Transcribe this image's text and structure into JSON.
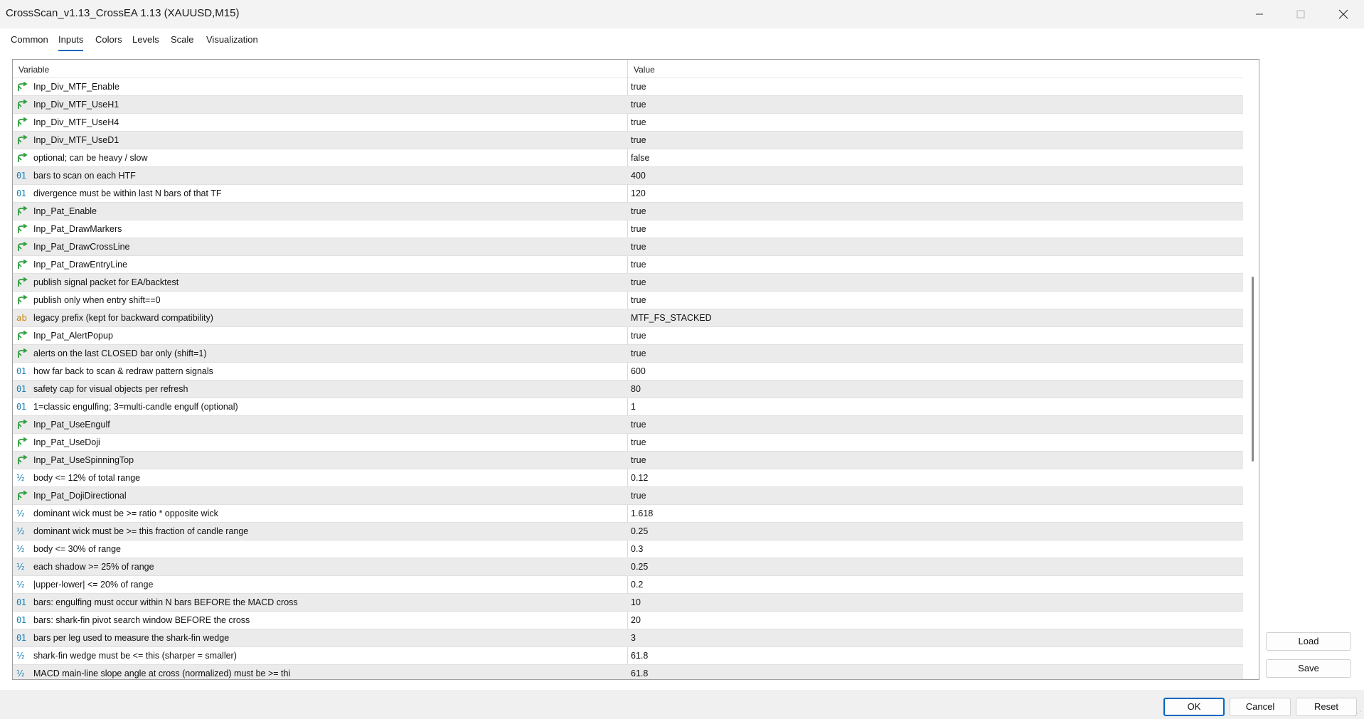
{
  "window": {
    "title": "CrossScan_v1.13_CrossEA 1.13 (XAUUSD,M15)"
  },
  "tabs": [
    {
      "label": "Common",
      "active": false
    },
    {
      "label": "Inputs",
      "active": true
    },
    {
      "label": "Colors",
      "active": false
    },
    {
      "label": "Levels",
      "active": false
    },
    {
      "label": "Scale",
      "active": false
    },
    {
      "label": "Visualization",
      "active": false
    }
  ],
  "grid": {
    "columns": {
      "variable": "Variable",
      "value": "Value"
    },
    "rows": [
      {
        "type": "bool",
        "name": "Inp_Div_MTF_Enable",
        "value": "true"
      },
      {
        "type": "bool",
        "name": "Inp_Div_MTF_UseH1",
        "value": "true"
      },
      {
        "type": "bool",
        "name": "Inp_Div_MTF_UseH4",
        "value": "true"
      },
      {
        "type": "bool",
        "name": "Inp_Div_MTF_UseD1",
        "value": "true"
      },
      {
        "type": "bool",
        "name": "optional; can be heavy / slow",
        "value": "false"
      },
      {
        "type": "int",
        "name": "bars to scan on each HTF",
        "value": "400"
      },
      {
        "type": "int",
        "name": "divergence must be within last N bars of that TF",
        "value": "120"
      },
      {
        "type": "bool",
        "name": "Inp_Pat_Enable",
        "value": "true"
      },
      {
        "type": "bool",
        "name": "Inp_Pat_DrawMarkers",
        "value": "true"
      },
      {
        "type": "bool",
        "name": "Inp_Pat_DrawCrossLine",
        "value": "true"
      },
      {
        "type": "bool",
        "name": "Inp_Pat_DrawEntryLine",
        "value": "true"
      },
      {
        "type": "bool",
        "name": "publish signal packet for EA/backtest",
        "value": "true"
      },
      {
        "type": "bool",
        "name": "publish only when entry shift==0",
        "value": "true"
      },
      {
        "type": "string",
        "name": "legacy prefix (kept for backward compatibility)",
        "value": "MTF_FS_STACKED"
      },
      {
        "type": "bool",
        "name": "Inp_Pat_AlertPopup",
        "value": "true"
      },
      {
        "type": "bool",
        "name": "alerts on the last CLOSED bar only (shift=1)",
        "value": "true"
      },
      {
        "type": "int",
        "name": "how far back to scan & redraw pattern signals",
        "value": "600"
      },
      {
        "type": "int",
        "name": "safety cap for visual objects per refresh",
        "value": "80"
      },
      {
        "type": "int",
        "name": "1=classic engulfing; 3=multi-candle engulf (optional)",
        "value": "1"
      },
      {
        "type": "bool",
        "name": "Inp_Pat_UseEngulf",
        "value": "true"
      },
      {
        "type": "bool",
        "name": "Inp_Pat_UseDoji",
        "value": "true"
      },
      {
        "type": "bool",
        "name": "Inp_Pat_UseSpinningTop",
        "value": "true"
      },
      {
        "type": "double",
        "name": "body <= 12% of total range",
        "value": "0.12"
      },
      {
        "type": "bool",
        "name": "Inp_Pat_DojiDirectional",
        "value": "true"
      },
      {
        "type": "double",
        "name": "dominant wick must be >= ratio * opposite wick",
        "value": "1.618"
      },
      {
        "type": "double",
        "name": "dominant wick must be >= this fraction of candle range",
        "value": "0.25"
      },
      {
        "type": "double",
        "name": "body <= 30% of range",
        "value": "0.3"
      },
      {
        "type": "double",
        "name": "each shadow >= 25% of range",
        "value": "0.25"
      },
      {
        "type": "double",
        "name": "|upper-lower| <= 20% of range",
        "value": "0.2"
      },
      {
        "type": "int",
        "name": "bars: engulfing must occur within N bars BEFORE the MACD cross",
        "value": "10"
      },
      {
        "type": "int",
        "name": "bars: shark-fin pivot search window BEFORE the cross",
        "value": "20"
      },
      {
        "type": "int",
        "name": "bars per leg used to measure the shark-fin wedge",
        "value": "3"
      },
      {
        "type": "double",
        "name": "shark-fin wedge must be <= this (sharper = smaller)",
        "value": "61.8"
      },
      {
        "type": "double",
        "name": "MACD main-line slope angle at cross (normalized) must be >= thi",
        "value": "61.8"
      }
    ]
  },
  "icons": {
    "bool": {
      "name": "bool-arrow-icon",
      "glyph": "",
      "color": "#2e9e3e"
    },
    "int": {
      "name": "integer-icon",
      "glyph": "01",
      "color": "#1a7fb5"
    },
    "double": {
      "name": "double-icon",
      "glyph": "½",
      "color": "#1a7fb5"
    },
    "string": {
      "name": "string-icon",
      "glyph": "ab",
      "color": "#c9871b"
    }
  },
  "side_buttons": {
    "load": "Load",
    "save": "Save"
  },
  "footer": {
    "ok": "OK",
    "cancel": "Cancel",
    "reset": "Reset"
  },
  "colors": {
    "accent": "#0067c0",
    "row_alt": "#ebebeb"
  }
}
